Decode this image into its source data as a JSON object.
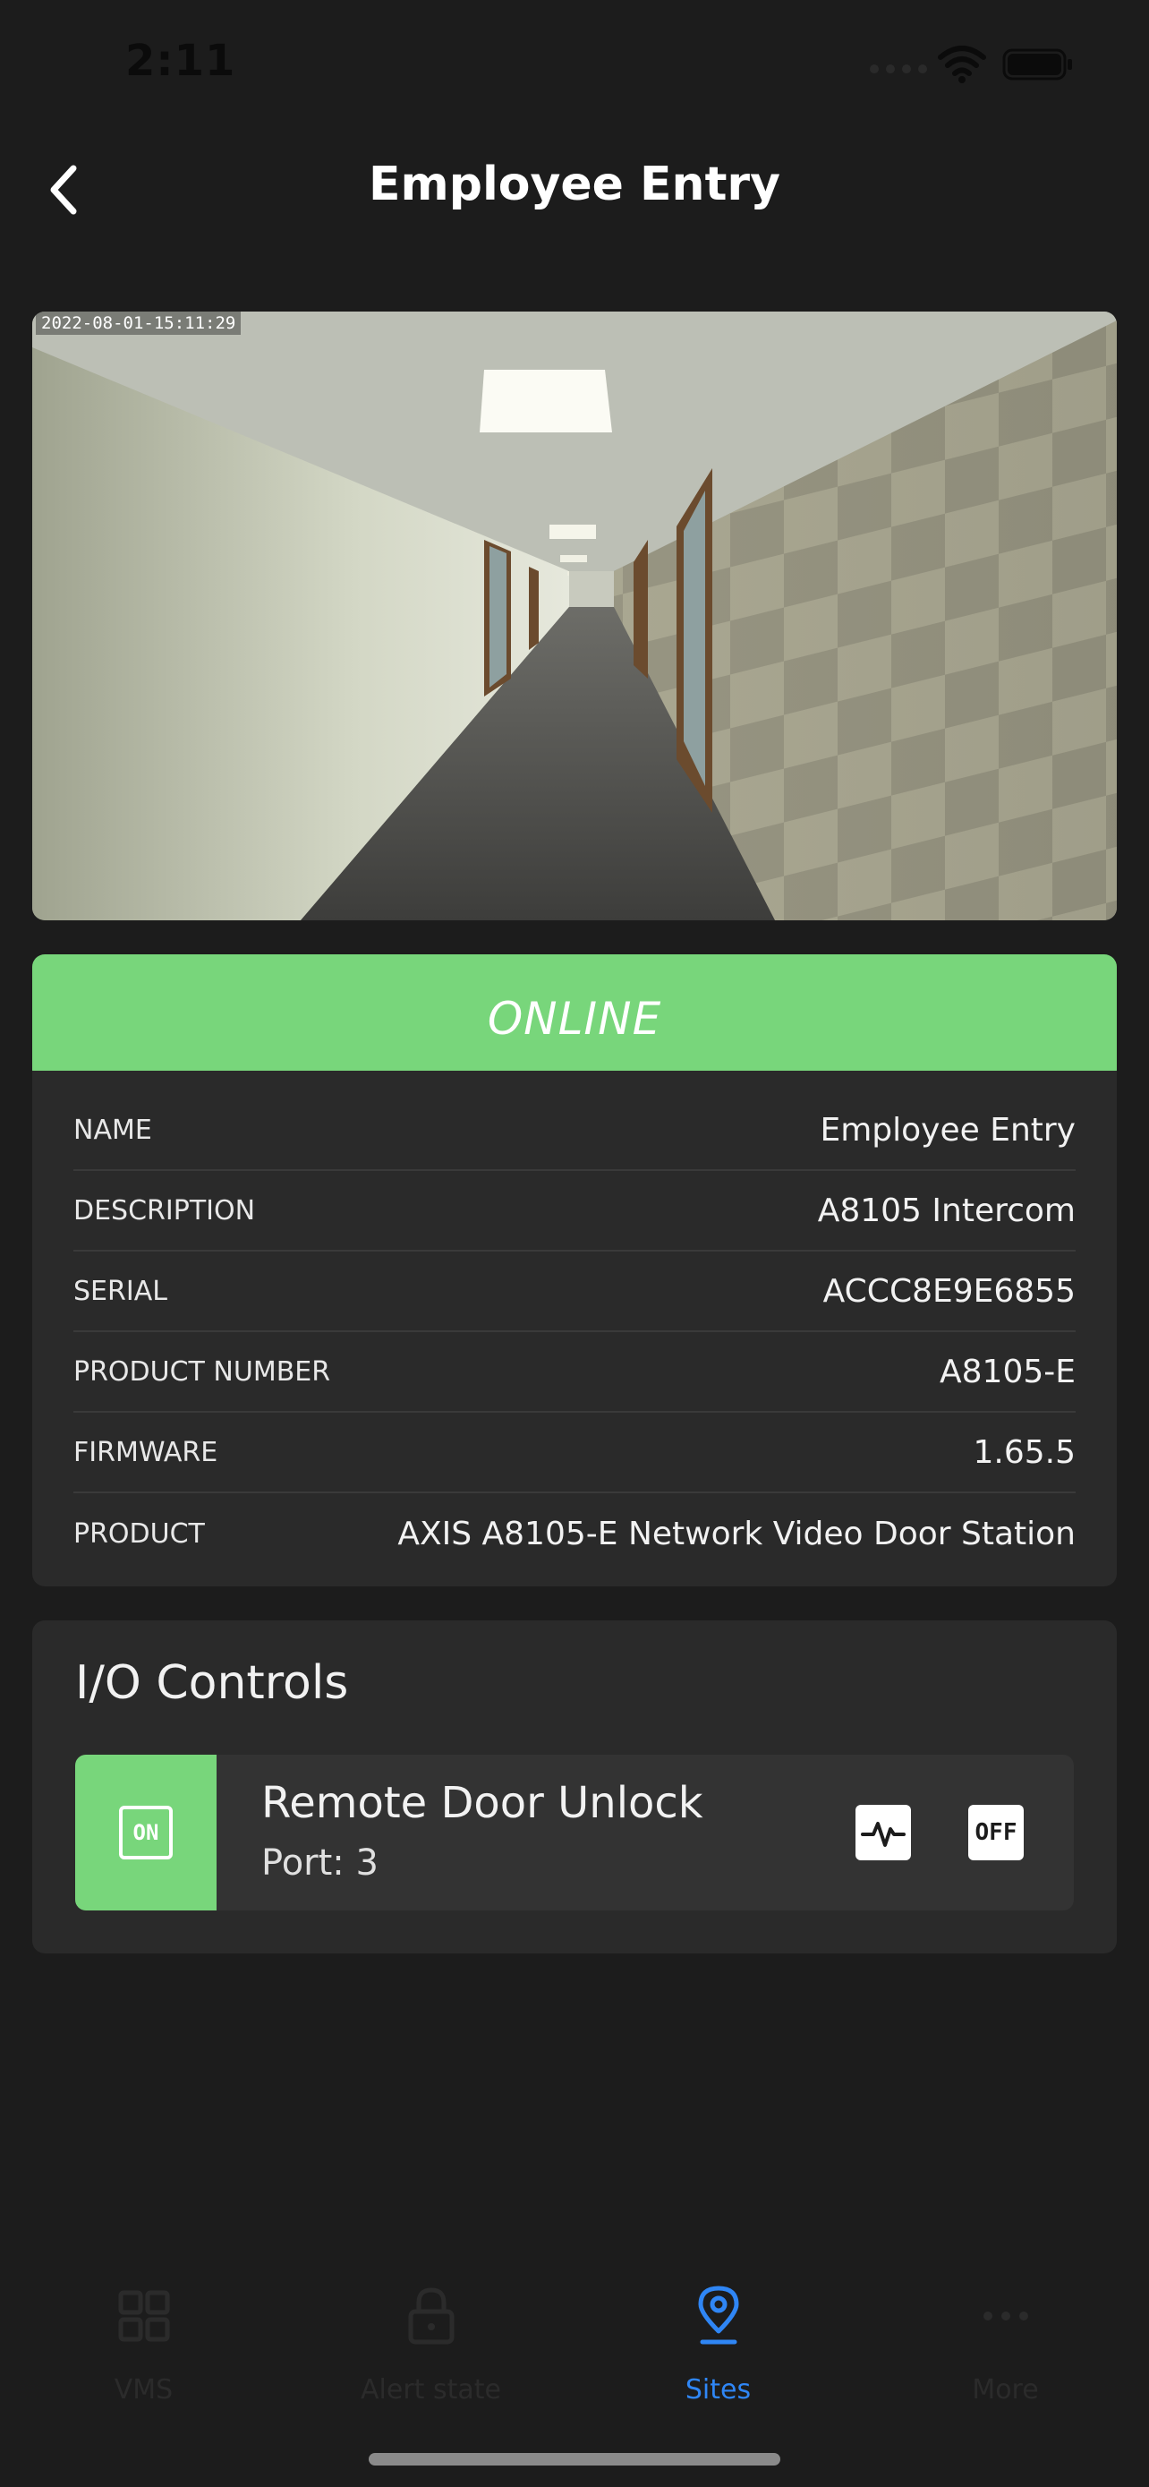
{
  "status_bar": {
    "time": "2:11"
  },
  "header": {
    "title": "Employee Entry"
  },
  "camera": {
    "timestamp": "2022-08-01-15:11:29"
  },
  "status": {
    "label": "ONLINE",
    "color": "#78d67b"
  },
  "details": [
    {
      "label": "NAME",
      "value": "Employee Entry"
    },
    {
      "label": "DESCRIPTION",
      "value": "A8105 Intercom"
    },
    {
      "label": "SERIAL",
      "value": "ACCC8E9E6855"
    },
    {
      "label": "PRODUCT NUMBER",
      "value": "A8105-E"
    },
    {
      "label": "FIRMWARE",
      "value": "1.65.5"
    },
    {
      "label": "PRODUCT",
      "value": "AXIS A8105-E Network Video Door Station"
    }
  ],
  "io_controls": {
    "title": "I/O Controls",
    "items": [
      {
        "name": "Remote Door Unlock",
        "port": "Port: 3",
        "state": "ON",
        "off_label": "OFF"
      }
    ]
  },
  "tab_bar": {
    "items": [
      {
        "label": "VMS",
        "icon": "grid-icon",
        "active": false
      },
      {
        "label": "Alert state",
        "icon": "lock-icon",
        "active": false
      },
      {
        "label": "Sites",
        "icon": "location-pin-icon",
        "active": true
      },
      {
        "label": "More",
        "icon": "more-dots-icon",
        "active": false
      }
    ]
  },
  "colors": {
    "accent": "#2f86f5",
    "online": "#78d67b",
    "background": "#1c1c1c",
    "card": "#2a2a2a"
  }
}
